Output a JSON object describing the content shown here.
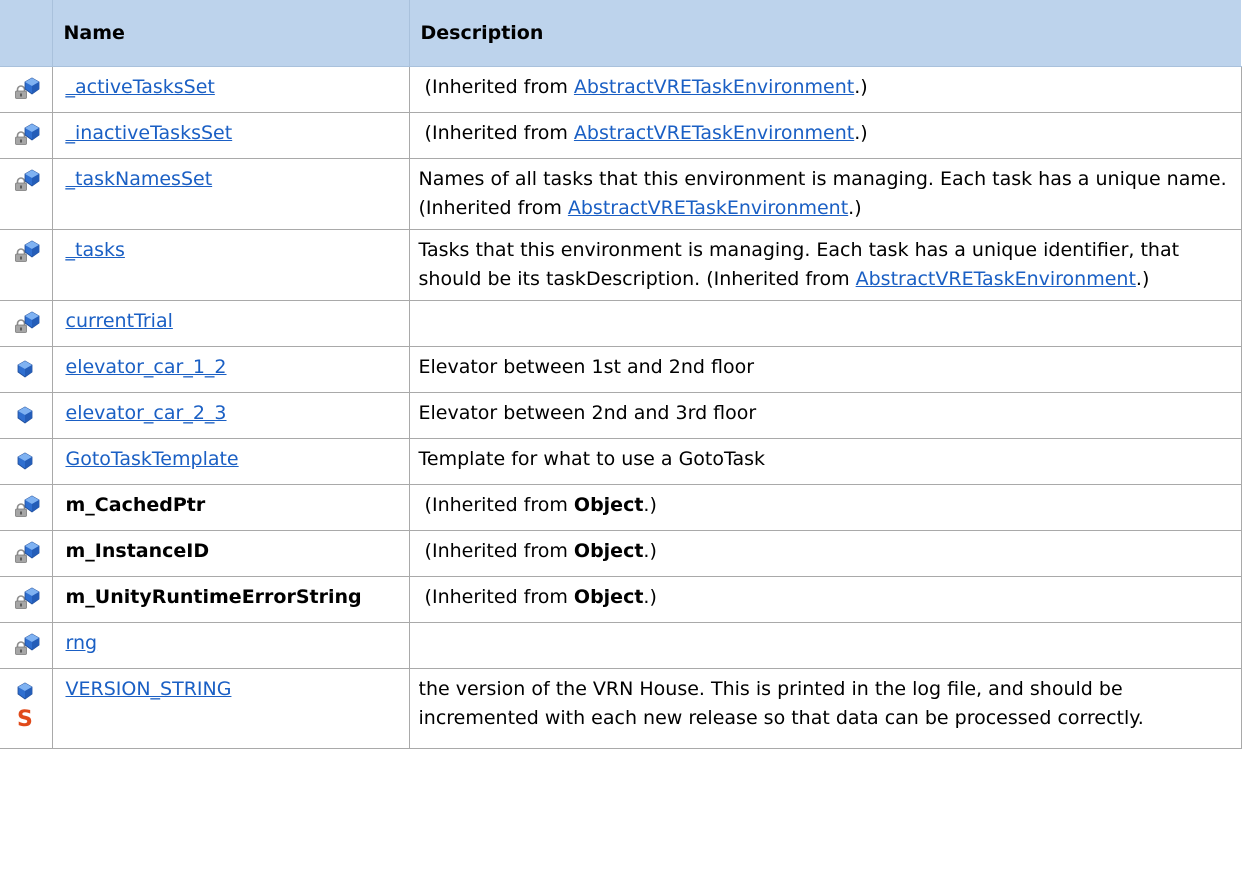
{
  "header": {
    "icon": "",
    "name": "Name",
    "description": "Description"
  },
  "inherited_prefix": "(Inherited from ",
  "inherited_suffix": ".)",
  "rows": [
    {
      "icon": "protected-field-icon",
      "name": "_activeTasksSet",
      "link": true,
      "desc": "",
      "inherit": "AbstractVRETaskEnvironment",
      "inherit_link": true
    },
    {
      "icon": "protected-field-icon",
      "name": "_inactiveTasksSet",
      "link": true,
      "desc": "",
      "inherit": "AbstractVRETaskEnvironment",
      "inherit_link": true
    },
    {
      "icon": "protected-field-icon",
      "name": "_taskNamesSet",
      "link": true,
      "desc": "Names of all tasks that this environment is managing. Each task has a unique name.",
      "inherit": "AbstractVRETaskEnvironment",
      "inherit_link": true
    },
    {
      "icon": "protected-field-icon",
      "name": "_tasks",
      "link": true,
      "desc": "Tasks that this environment is managing. Each task has a unique identifier, that should be its taskDescription.",
      "inherit": "AbstractVRETaskEnvironment",
      "inherit_link": true
    },
    {
      "icon": "protected-field-icon",
      "name": "currentTrial",
      "link": true,
      "desc": "",
      "inherit": "",
      "inherit_link": false
    },
    {
      "icon": "public-field-icon",
      "name": "elevator_car_1_2",
      "link": true,
      "desc": "Elevator between 1st and 2nd floor",
      "inherit": "",
      "inherit_link": false
    },
    {
      "icon": "public-field-icon",
      "name": "elevator_car_2_3",
      "link": true,
      "desc": "Elevator between 2nd and 3rd floor",
      "inherit": "",
      "inherit_link": false
    },
    {
      "icon": "public-field-icon",
      "name": "GotoTaskTemplate",
      "link": true,
      "desc": "Template for what to use a GotoTask",
      "inherit": "",
      "inherit_link": false
    },
    {
      "icon": "protected-field-icon",
      "name": "m_CachedPtr",
      "link": false,
      "desc": "",
      "inherit": "Object",
      "inherit_link": false
    },
    {
      "icon": "protected-field-icon",
      "name": "m_InstanceID",
      "link": false,
      "desc": "",
      "inherit": "Object",
      "inherit_link": false
    },
    {
      "icon": "protected-field-icon",
      "name": "m_UnityRuntimeErrorString",
      "link": false,
      "desc": "",
      "inherit": "Object",
      "inherit_link": false
    },
    {
      "icon": "protected-field-icon",
      "name": "rng",
      "link": true,
      "desc": "",
      "inherit": "",
      "inherit_link": false
    },
    {
      "icon": "public-static-field-icon",
      "static_glyph": "S",
      "name": "VERSION_STRING",
      "link": true,
      "desc": "the version of the VRN House. This is printed in the log file, and should be incremented with each new release so that data can be processed correctly.",
      "inherit": "",
      "inherit_link": false
    }
  ]
}
